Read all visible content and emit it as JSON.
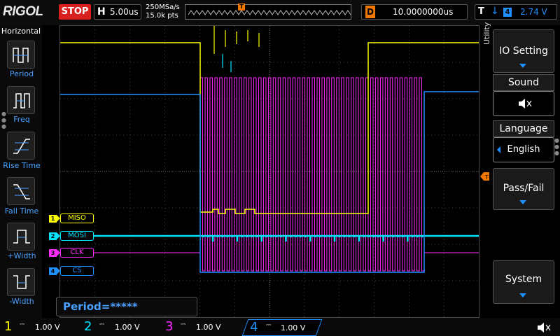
{
  "topbar": {
    "logo": "RIGOL",
    "run_state": "STOP",
    "horizontal_label": "H",
    "timebase": "5.00us",
    "sample_rate": "250MSa/s",
    "memory_depth": "15.0k pts",
    "trigger_marker": "T",
    "delay_label": "D",
    "delay_value": "10.0000000us",
    "trigger_label": "T",
    "trigger_source": "4",
    "trigger_level": "2.74 V"
  },
  "left_menu": {
    "title": "Horizontal",
    "items": [
      {
        "label": "Period",
        "icon": "period-icon"
      },
      {
        "label": "Freq",
        "icon": "freq-icon"
      },
      {
        "label": "Rise Time",
        "icon": "rise-time-icon"
      },
      {
        "label": "Fall Time",
        "icon": "fall-time-icon"
      },
      {
        "label": "+Width",
        "icon": "positive-width-icon"
      },
      {
        "label": "-Width",
        "icon": "negative-width-icon"
      }
    ]
  },
  "right_menu": {
    "side_title": "Utility",
    "io_setting": "IO Setting",
    "sound_label": "Sound",
    "language_label": "Language",
    "language_value": "English",
    "pass_fail": "Pass/Fail",
    "system": "System"
  },
  "channels": [
    {
      "num": "1",
      "name": "MISO",
      "color": "#ffff00",
      "scale": "1.00 V"
    },
    {
      "num": "2",
      "name": "MOSI",
      "color": "#00e5ff",
      "scale": "1.00 V"
    },
    {
      "num": "3",
      "name": "CLK",
      "color": "#ff2bff",
      "scale": "1.00 V"
    },
    {
      "num": "4",
      "name": "CS",
      "color": "#1e90ff",
      "scale": "1.00 V"
    }
  ],
  "measurement": {
    "readout": "Period=*****"
  },
  "colors": {
    "accent": "#1e90ff",
    "trigger": "#f07800",
    "stop": "#d82020"
  }
}
